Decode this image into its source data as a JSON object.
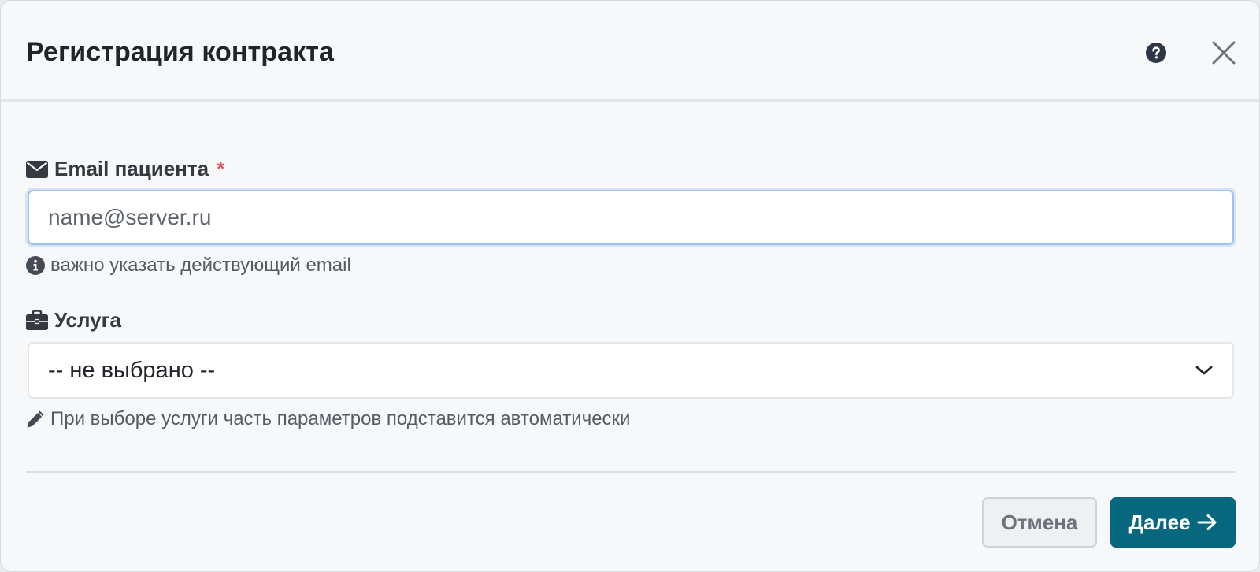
{
  "dialog": {
    "title": "Регистрация контракта"
  },
  "email_field": {
    "label": "Email пациента",
    "required_mark": "*",
    "placeholder": "name@server.ru",
    "value": "",
    "hint": "важно указать действующий email"
  },
  "service_field": {
    "label": "Услуга",
    "selected": "-- не выбрано --",
    "hint": "При выборе услуги часть параметров подставится автоматически"
  },
  "footer": {
    "cancel_label": "Отмена",
    "next_label": "Далее"
  },
  "colors": {
    "primary": "#07677f",
    "required": "#e25555",
    "input_focus_border": "#9ec1ee"
  },
  "icons": [
    "help-circle-icon",
    "close-icon",
    "envelope-icon",
    "info-circle-icon",
    "briefcase-icon",
    "chevron-down-icon",
    "pencil-icon",
    "arrow-right-icon"
  ]
}
